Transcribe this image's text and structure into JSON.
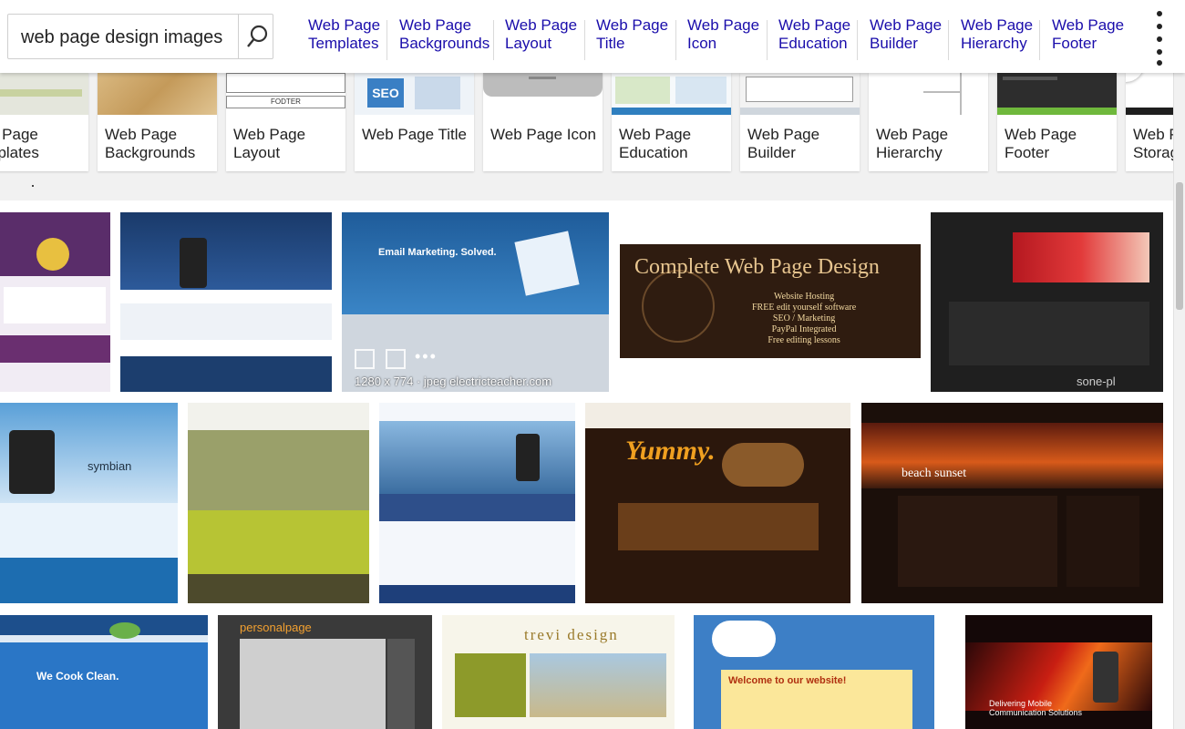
{
  "search": {
    "value": "web page design images",
    "button_icon": "search-icon"
  },
  "chips": [
    {
      "line1": "Web Page",
      "line2": "Templates"
    },
    {
      "line1": "Web Page",
      "line2": "Backgrounds"
    },
    {
      "line1": "Web Page",
      "line2": "Layout"
    },
    {
      "line1": "Web Page",
      "line2": "Title"
    },
    {
      "line1": "Web Page",
      "line2": "Icon"
    },
    {
      "line1": "Web Page",
      "line2": "Education"
    },
    {
      "line1": "Web Page",
      "line2": "Builder"
    },
    {
      "line1": "Web Page",
      "line2": "Hierarchy"
    },
    {
      "line1": "Web Page",
      "line2": "Footer"
    }
  ],
  "more_icon": "more-vertical-icon",
  "related": [
    {
      "line1": "b Page",
      "line2": "nplates"
    },
    {
      "line1": "Web Page",
      "line2": "Backgrounds"
    },
    {
      "line1": "Web Page",
      "line2": "Layout"
    },
    {
      "line1": "Web Page Title",
      "line2": ""
    },
    {
      "line1": "Web Page Icon",
      "line2": ""
    },
    {
      "line1": "Web Page",
      "line2": "Education"
    },
    {
      "line1": "Web Page",
      "line2": "Builder"
    },
    {
      "line1": "Web Page",
      "line2": "Hierarchy"
    },
    {
      "line1": "Web Page",
      "line2": "Footer"
    },
    {
      "line1": "Web P",
      "line2": "Storag"
    }
  ],
  "related_thumb_text": {
    "footer": "FODTER",
    "seo": "SEO"
  },
  "featured": {
    "title": "Complete Web Page Design",
    "lines": [
      "Website Hosting",
      "FREE edit yourself software",
      "SEO / Marketing",
      "PayPal Integrated",
      "Free editing lessons"
    ]
  },
  "image_info": "1280 x 774 · jpeg   electricteacher.com",
  "image_captions": {
    "email": "Email Marketing. Solved.",
    "yummy": "Yummy.",
    "beach": "beach sunset",
    "cook": "We Cook Clean.",
    "trevi": "trevi design",
    "welcome": "Welcome to our website!",
    "personal": "personalpage",
    "comm": "Delivering Mobile Communication Solutions",
    "symbian": "symbian",
    "sone": "sone-pl"
  },
  "colors": {
    "chip_link": "#1a0dab",
    "brown_bg": "#2f1c10",
    "dark_bg": "#1f1f1f"
  }
}
